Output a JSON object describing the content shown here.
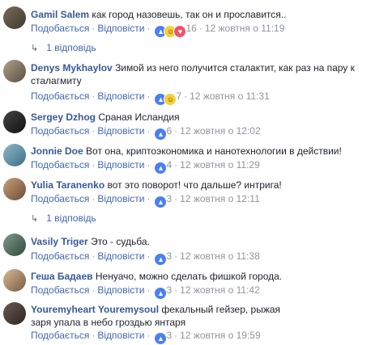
{
  "like_label": "Подобається",
  "reply_label": "Відповісти",
  "comments": [
    {
      "author": "Gamil Salem",
      "text": "как город назовешь, так он и прославится..",
      "reactions": "16",
      "time": "12 жовтня о 11:19",
      "replies": "1 відповідь"
    },
    {
      "author": "Denys Mykhaylov",
      "text": "Зимой из него получится сталактит, как раз на пару к сталагмиту",
      "reactions": "7",
      "time": "12 жовтня о 11:31"
    },
    {
      "author": "Sergey Dzhog",
      "text": "Сраная Исландия",
      "reactions": "6",
      "time": "12 жовтня о 12:02"
    },
    {
      "author": "Jonnie Doe",
      "text": "Вот она, криптоэкономика и нанотехнологии в действии!",
      "reactions": "4",
      "time": "12 жовтня о 11:29"
    },
    {
      "author": "Yulia Taranenko",
      "text": "вот это поворот! что дальше? интрига!",
      "reactions": "3",
      "time": "12 жовтня о 12:11",
      "replies": "1 відповідь"
    },
    {
      "author": "Vasily Triger",
      "text": "Это - судьба.",
      "reactions": "3",
      "time": "12 жовтня о 11:38"
    },
    {
      "author": "Геша Бадаев",
      "text": "Ненуачо, можно сделать фишкой города.",
      "reactions": "3",
      "time": "12 жовтня о 11:42"
    },
    {
      "author": "Youremyheart Youremysoul",
      "text": "фекальный гейзер, рыжая заря упала в небо гроздью янтаря",
      "reactions": "3",
      "time": "12 жовтня о 19:59"
    }
  ],
  "colors": {
    "link": "#4267b2",
    "author": "#385898",
    "meta": "#90949c"
  }
}
